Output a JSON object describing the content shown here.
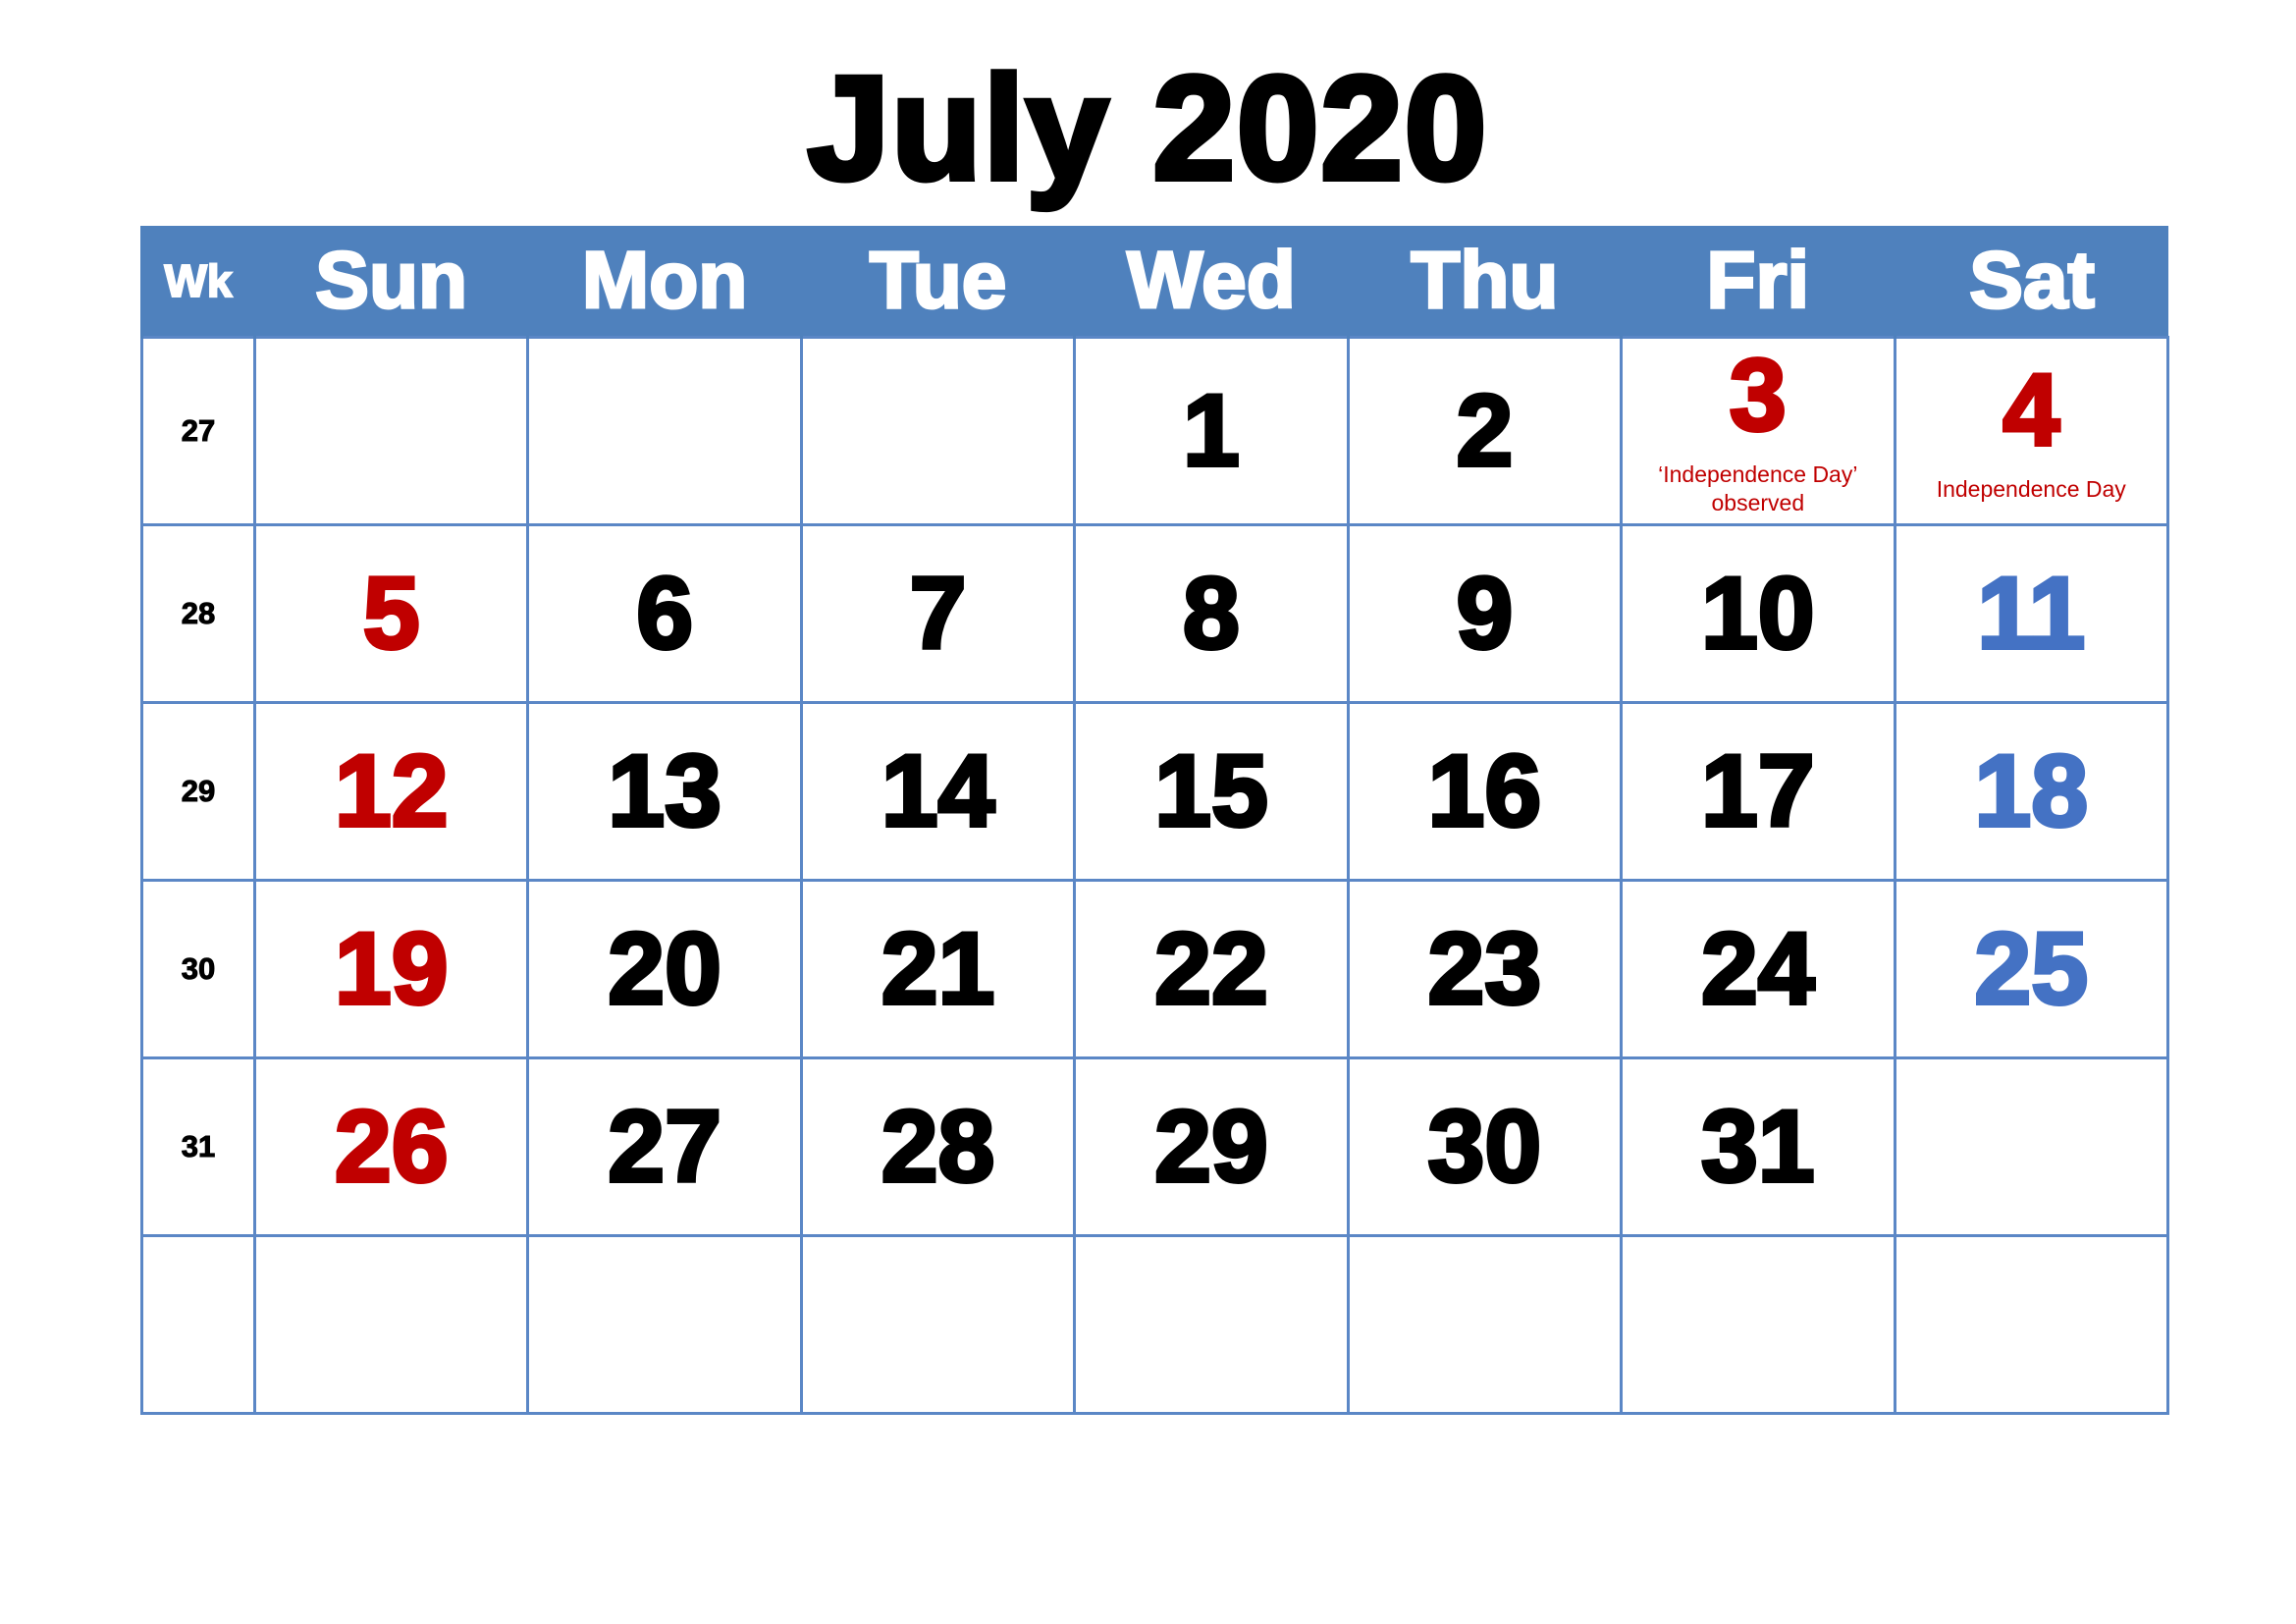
{
  "title": "July 2020",
  "colors": {
    "header_bg": "#4f81bd",
    "sunday_holiday": "#c00000",
    "saturday": "#4472c4",
    "grid": "#5b87c6"
  },
  "headers": [
    "Wk",
    "Sun",
    "Mon",
    "Tue",
    "Wed",
    "Thu",
    "Fri",
    "Sat"
  ],
  "weeks": [
    {
      "wk": "27",
      "days": [
        "",
        "",
        "",
        "1",
        "2",
        "3",
        "4"
      ]
    },
    {
      "wk": "28",
      "days": [
        "5",
        "6",
        "7",
        "8",
        "9",
        "10",
        "11"
      ]
    },
    {
      "wk": "29",
      "days": [
        "12",
        "13",
        "14",
        "15",
        "16",
        "17",
        "18"
      ]
    },
    {
      "wk": "30",
      "days": [
        "19",
        "20",
        "21",
        "22",
        "23",
        "24",
        "25"
      ]
    },
    {
      "wk": "31",
      "days": [
        "26",
        "27",
        "28",
        "29",
        "30",
        "31",
        ""
      ]
    },
    {
      "wk": "",
      "days": [
        "",
        "",
        "",
        "",
        "",
        "",
        ""
      ]
    }
  ],
  "holidays": {
    "3": "‘Independence Day’ observed",
    "4": "Independence Day"
  }
}
